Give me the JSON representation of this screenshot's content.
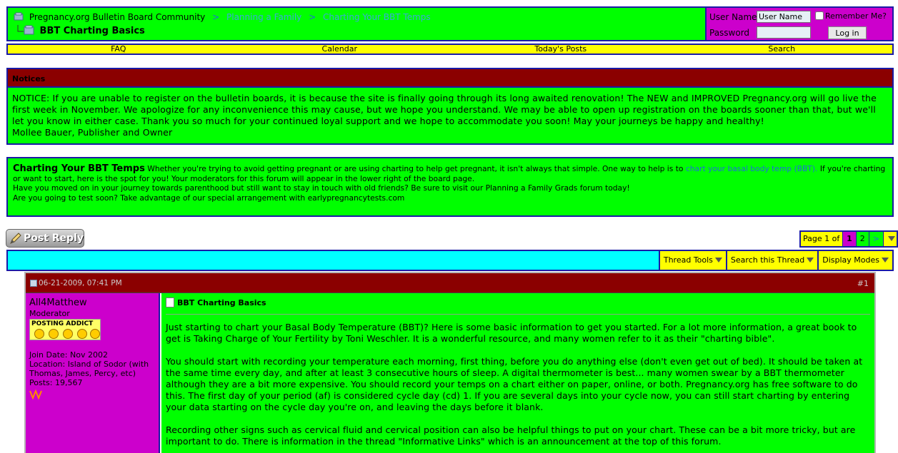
{
  "header": {
    "breadcrumb": {
      "home": "Pregnancy.org Bulletin Board Community",
      "separator": ">",
      "level1": "Planning a Family",
      "level2": "Charting Your BBT Temps"
    },
    "thread_title": "BBT Charting Basics"
  },
  "login": {
    "username_label": "User Name",
    "username_value": "User Name",
    "remember_label": "Remember Me?",
    "password_label": "Password",
    "login_button": "Log in"
  },
  "navbar": {
    "items": [
      "FAQ",
      "Calendar",
      "Today's Posts",
      "Search"
    ]
  },
  "notices": {
    "heading": "Notices",
    "text": "NOTICE: If you are unable to register on the bulletin boards, it is because the site is finally going through its long awaited renovation! The NEW and IMPROVED Pregnancy.org will go live the first week in November. We apologize for any inconvenience this may cause, but we hope you understand. We may be able to open up registration on the boards sooner than that, but we'll let you know in either case. Thank you so much for your continued loyal support and we hope to accommodate you soon! May your journeys be happy and healthy!",
    "signature": "Mollee Bauer, Publisher and Owner"
  },
  "forum": {
    "title": "Charting Your BBT Temps",
    "desc_part1": "Whether you're trying to avoid getting pregnant or are using charting to help get pregnant, it isn't always that simple. One way to help is to",
    "desc_highlight": "chart your basal body temp (BBT).",
    "desc_part2": "If you're charting or want to start, here is the spot for you! Your moderators for this forum will appear in the lower right of the board page.",
    "line2": "Have you moved on in your journey towards parenthood but still want to stay in touch with old friends? Be sure to visit our Planning a Family Grads forum today!",
    "line3": "Are you going to test soon? Take advantage of our special arrangement with earlypregnancytests.com"
  },
  "toolbar": {
    "post_reply": "Post Reply",
    "thread_tools": "Thread Tools",
    "search_thread": "Search this Thread",
    "display_modes": "Display Modes"
  },
  "pagination": {
    "info": "Page 1 of 2",
    "current": "1",
    "next_page": "2",
    "next_arrow": ">"
  },
  "post": {
    "date": "06-21-2009, 07:41 PM",
    "number": "#1",
    "author": {
      "name": "All4Matthew",
      "title": "Moderator",
      "rank_text": "POSTING ADDICT",
      "join_date": "Join Date: Nov 2002",
      "location": "Location: Island of Sodor (with Thomas, James, Percy, etc)",
      "posts": "Posts: 19,567"
    },
    "title": "BBT Charting Basics",
    "paragraphs": [
      "Just starting to chart your Basal Body Temperature (BBT)? Here is some basic information to get you started. For a lot more information, a great book to get is Taking Charge of Your Fertility by Toni Weschler. It is a wonderful resource, and many women refer to it as their \"charting bible\".",
      "You should start with recording your temperature each morning, first thing, before you do anything else (don't even get out of bed). It should be taken at the same time every day, and after at least 3 consecutive hours of sleep. A digital thermometer is best... many women swear by a BBT thermometer although they are a bit more expensive. You should record your temps on a chart either on paper, online, or both. Pregnancy.org has free software to do this. The first day of your period (af) is considered cycle day (cd) 1. If you are several days into your cycle now, you can still start charting by entering your data starting on the cycle day you're on, and leaving the days before it blank.",
      "Recording other signs such as cervical fluid and cervical position can also be helpful things to put on your chart. These can be a bit more tricky, but are important to do. There is information in the thread \"Informative Links\" which is an announcement at the top of this forum."
    ]
  },
  "colors": {
    "panel_green": "#00ff00",
    "border_blue": "#1a1aa6",
    "header_darkred": "#8b0000",
    "login_magenta": "#cc00cc",
    "nav_yellow": "#ffff00",
    "toolbar_cyan": "#00ffff"
  }
}
